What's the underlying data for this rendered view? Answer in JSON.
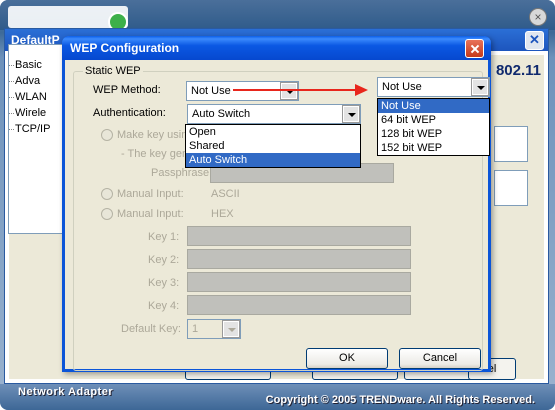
{
  "bg_app": {
    "window_title": "DefaultP",
    "brand_badge": "802.11",
    "tree_items": [
      "Basic",
      "Adva",
      "WLAN",
      "Wirele",
      "TCP/IP"
    ],
    "bottom_buttons": [
      "",
      "",
      "",
      "el"
    ],
    "footer_left": "Network Adapter",
    "footer_right": "Copyright © 2005 TRENDware. All Rights Reserved."
  },
  "dialog": {
    "title": "WEP Configuration",
    "group_label": "Static WEP",
    "wep_method_label": "WEP Method:",
    "wep_method_value": "Not Use",
    "wep_method_open": {
      "value": "Not Use",
      "options": [
        "Not Use",
        "64 bit WEP",
        "128 bit WEP",
        "152 bit WEP"
      ],
      "selected": "Not Use"
    },
    "auth_label": "Authentication:",
    "auth_value": "Auto Switch",
    "auth_options": [
      "Open",
      "Shared",
      "Auto Switch"
    ],
    "auth_selected": "Auto Switch",
    "make_key_label": "Make key using",
    "key_gen_label": "- The key gene",
    "passphrase_label": "Passphrase:",
    "manual_ascii_label": "Manual Input:",
    "manual_ascii_type": "ASCII",
    "manual_hex_label": "Manual Input:",
    "manual_hex_type": "HEX",
    "key_labels": [
      "Key 1:",
      "Key 2:",
      "Key 3:",
      "Key 4:"
    ],
    "default_key_label": "Default Key:",
    "default_key_value": "1",
    "ok_label": "OK",
    "cancel_label": "Cancel"
  },
  "colors": {
    "title_bar": "#0b58e3",
    "selection": "#316ac5",
    "arrow": "#e8261c"
  }
}
